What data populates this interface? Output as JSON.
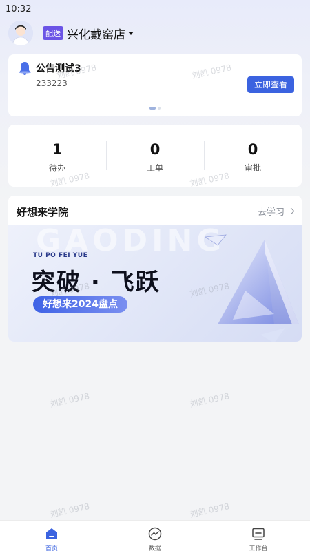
{
  "status_bar": {
    "time": "10:32"
  },
  "header": {
    "store_tag": "配送",
    "store_name": "兴化戴窑店"
  },
  "notice": {
    "title": "公告测试3",
    "body": "233223",
    "button_label": "立即查看"
  },
  "stats": [
    {
      "value": "1",
      "label": "待办"
    },
    {
      "value": "0",
      "label": "工单"
    },
    {
      "value": "0",
      "label": "审批"
    }
  ],
  "academy": {
    "title": "好想来学院",
    "link_label": "去学习",
    "banner": {
      "bg_text": "GAODING",
      "subtitle": "TU PO FEI YUE",
      "headline": "突破 · 飞跃",
      "pill": "好想来2024盘点"
    }
  },
  "watermark": "刘凯 0978",
  "tabbar": [
    {
      "label": "首页",
      "icon": "home-icon",
      "active": true
    },
    {
      "label": "数据",
      "icon": "data-chart-icon",
      "active": false
    },
    {
      "label": "工作台",
      "icon": "workbench-icon",
      "active": false
    }
  ],
  "colors": {
    "accent": "#3b63e0",
    "tag": "#6b54e6"
  }
}
